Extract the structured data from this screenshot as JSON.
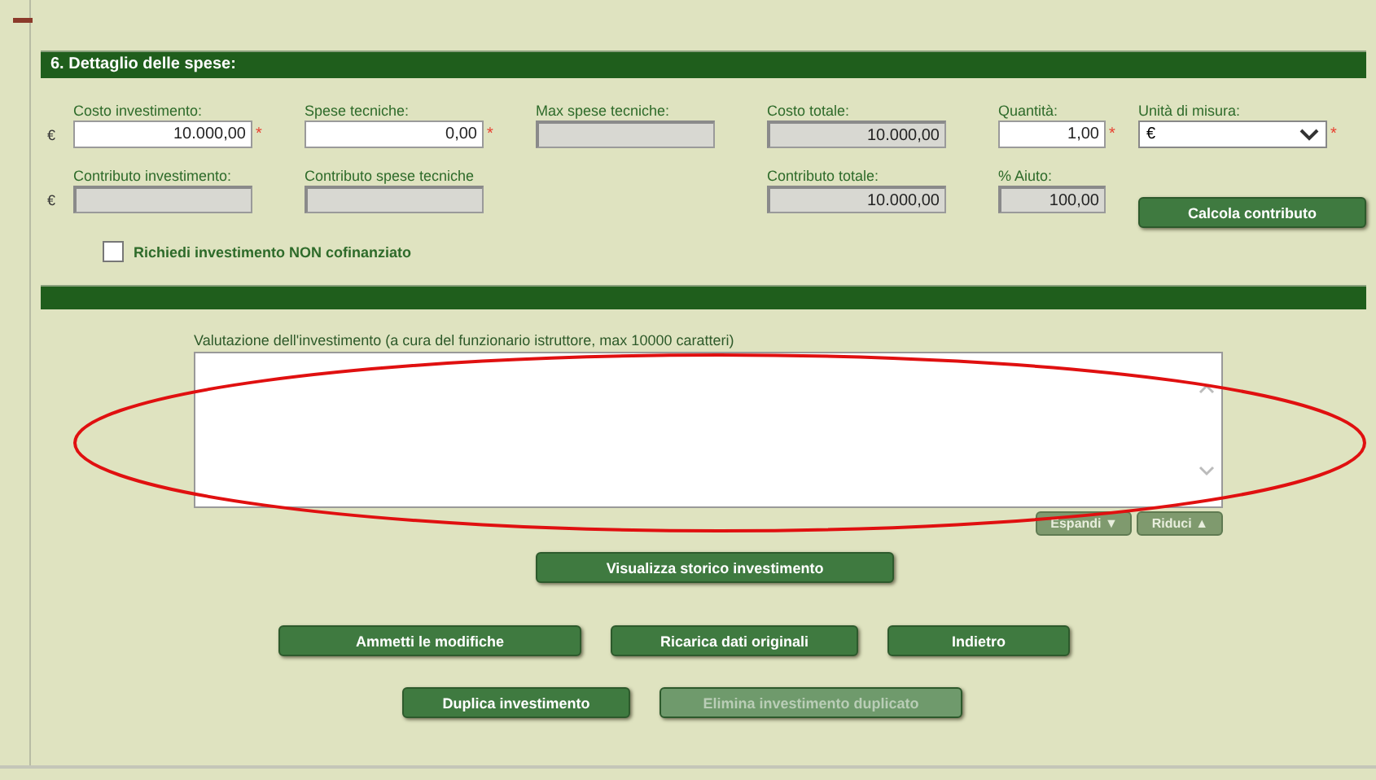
{
  "section": {
    "title": "6. Dettaglio delle spese:"
  },
  "fields_row_1": [
    {
      "label": "Costo investimento:",
      "currency": "€",
      "value": "10.000,00",
      "editable": true,
      "required_mark": "*"
    },
    {
      "label": "Spese tecniche:",
      "value": "0,00",
      "editable": true,
      "required_mark": "*"
    },
    {
      "label": "Max spese tecniche:",
      "editable": false
    },
    {
      "label": "Costo totale:",
      "value": "10.000,00",
      "editable": false
    },
    {
      "label": "Quantità:",
      "value": "1,00",
      "editable": true,
      "required_mark": "*"
    }
  ],
  "unit_select": {
    "label": "Unità di misura:",
    "value": "€",
    "required_mark": "*"
  },
  "fields_row_2": [
    {
      "label": "Contributo investimento:",
      "currency": "€",
      "editable": false
    },
    {
      "label": "Contributo spese tecniche",
      "editable": false
    },
    {
      "label": "Contributo totale:",
      "value": "10.000,00",
      "editable": false
    },
    {
      "label": "% Aiuto:",
      "value": "100,00",
      "editable": false
    }
  ],
  "calc_button": "Calcola contributo",
  "checkbox": {
    "label": "Richiedi investimento NON cofinanziato",
    "checked": false
  },
  "evaluation": {
    "label": "Valutazione dell'investimento (a cura del funzionario istruttore, max 10000 caratteri)",
    "annotated": true
  },
  "text_buttons": [
    "Espandi ▼",
    "Riduci ▲"
  ],
  "button_rows": [
    [
      {
        "label": "Visualizza storico investimento",
        "disabled": false
      }
    ],
    [
      {
        "label": "Ammetti le modifiche",
        "disabled": false
      },
      {
        "label": "Ricarica dati originali",
        "disabled": false
      },
      {
        "label": "Indietro",
        "disabled": false
      }
    ],
    [
      {
        "label": "Duplica investimento",
        "disabled": false
      },
      {
        "label": "Elimina investimento duplicato",
        "disabled": true
      }
    ]
  ]
}
